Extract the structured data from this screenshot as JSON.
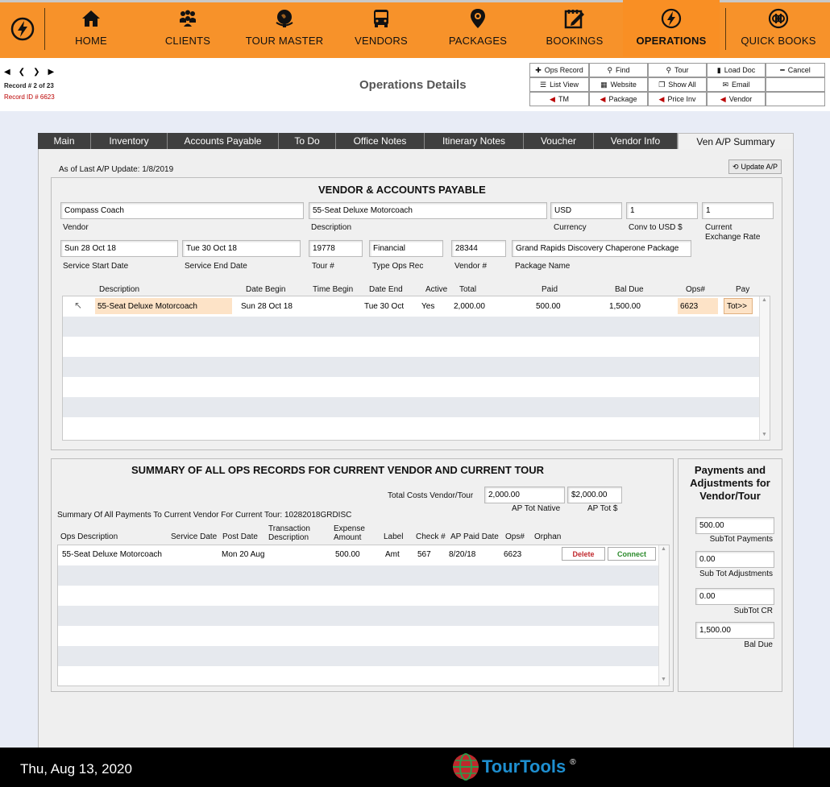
{
  "nav": {
    "items": [
      {
        "label": "HOME",
        "icon": "home-icon"
      },
      {
        "label": "CLIENTS",
        "icon": "clients-icon"
      },
      {
        "label": "TOUR MASTER",
        "icon": "globe-icon"
      },
      {
        "label": "VENDORS",
        "icon": "bus-icon"
      },
      {
        "label": "PACKAGES",
        "icon": "location-pin-icon"
      },
      {
        "label": "BOOKINGS",
        "icon": "booking-edit-icon"
      },
      {
        "label": "OPERATIONS",
        "icon": "lightning-icon"
      },
      {
        "label": "QUICK BOOKS",
        "icon": "quickbooks-icon"
      }
    ],
    "active": "OPERATIONS",
    "accent": "#f7922a"
  },
  "header": {
    "record_num": "Record # 2 of 23",
    "record_id": "Record ID # 6623",
    "title": "Operations Details",
    "buttons": [
      {
        "label": "Ops Record",
        "icon": "plus-icon"
      },
      {
        "label": "Find",
        "icon": "search-icon"
      },
      {
        "label": "Tour",
        "icon": "search-icon"
      },
      {
        "label": "Load Doc",
        "icon": "document-icon"
      },
      {
        "label": "Cancel",
        "icon": "minus-icon"
      },
      {
        "label": "List View",
        "icon": "list-icon"
      },
      {
        "label": "Website",
        "icon": "table-icon"
      },
      {
        "label": "Show All",
        "icon": "copy-icon"
      },
      {
        "label": "Email",
        "icon": "envelope-icon"
      },
      {
        "label": "",
        "icon": "blank"
      },
      {
        "label": "TM",
        "icon": "caret-left-icon"
      },
      {
        "label": "Package",
        "icon": "caret-left-icon"
      },
      {
        "label": "Price Inv",
        "icon": "caret-left-icon"
      },
      {
        "label": "Vendor",
        "icon": "caret-left-icon"
      },
      {
        "label": "",
        "icon": "blank"
      }
    ]
  },
  "tabs": [
    "Main",
    "Inventory",
    "Accounts Payable",
    "To Do",
    "Office Notes",
    "Itinerary Notes",
    "Voucher",
    "Vendor Info",
    "Ven A/P Summary"
  ],
  "active_tab": "Ven A/P Summary",
  "ap": {
    "last_update": "As of Last A/P Update: 1/8/2019",
    "update_btn": "Update A/P",
    "section_title": "VENDOR & ACCOUNTS PAYABLE",
    "vendor": {
      "value": "Compass Coach",
      "label": "Vendor"
    },
    "description": {
      "value": "55-Seat Deluxe Motorcoach",
      "label": "Description"
    },
    "currency": {
      "value": "USD",
      "label": "Currency"
    },
    "conv": {
      "value": "1",
      "label": "Conv to USD $"
    },
    "exchange": {
      "value": "1",
      "label": "Current Exchange Rate"
    },
    "start_date": {
      "value": "Sun 28 Oct 18",
      "label": "Service Start Date"
    },
    "end_date": {
      "value": "Tue 30 Oct 18",
      "label": "Service End Date"
    },
    "tour_num": {
      "value": "19778",
      "label": "Tour #"
    },
    "type_ops": {
      "value": "Financial",
      "label": "Type Ops Rec"
    },
    "vendor_num": {
      "value": "28344",
      "label": "Vendor #"
    },
    "package_name": {
      "value": "Grand Rapids Discovery Chaperone Package",
      "label": "Package Name"
    },
    "columns": [
      "Description",
      "Date Begin",
      "Time Begin",
      "Date End",
      "Active",
      "Total",
      "Paid",
      "Bal Due",
      "Ops#",
      "Pay"
    ],
    "row": {
      "description": "55-Seat Deluxe Motorcoach",
      "date_begin": "Sun 28 Oct 18",
      "time_begin": "",
      "date_end": "Tue 30 Oct",
      "active": "Yes",
      "total": "2,000.00",
      "paid": "500.00",
      "bal_due": "1,500.00",
      "ops": "6623",
      "pay": "Tot>>"
    }
  },
  "summary": {
    "title": "SUMMARY OF ALL OPS RECORDS FOR CURRENT VENDOR AND CURRENT TOUR",
    "total_costs_label": "Total Costs Vendor/Tour",
    "ap_native": "2,000.00",
    "ap_native_label": "AP Tot Native",
    "ap_usd": "$2,000.00",
    "ap_usd_label": "AP Tot $",
    "payments_line": "Summary Of All Payments To Current Vendor For Current Tour: 10282018GRDISC",
    "columns": {
      "ops_desc": "Ops Description",
      "service_date": "Service Date",
      "post_date": "Post Date",
      "trans_desc": "Transaction Description",
      "expense": "Expense Amount",
      "label": "Label",
      "check": "Check #",
      "ap_paid": "AP Paid Date",
      "ops": "Ops#",
      "orphan": "Orphan"
    },
    "row": {
      "ops_desc": "55-Seat Deluxe Motorcoach",
      "service_date": "",
      "post_date": "Mon 20 Aug",
      "trans_desc": "",
      "expense": "500.00",
      "label": "Amt",
      "check": "567",
      "ap_paid": "8/20/18",
      "ops": "6623",
      "delete": "Delete",
      "connect": "Connect"
    }
  },
  "payments": {
    "title": "Payments and Adjustments for Vendor/Tour",
    "subtot_payments": "500.00",
    "subtot_payments_label": "SubTot Payments",
    "subtot_adjust": "0.00",
    "subtot_adjust_label": "Sub Tot Adjustments",
    "subtot_cr": "0.00",
    "subtot_cr_label": "SubTot CR",
    "bal_due": "1,500.00",
    "bal_due_label": "Bal Due"
  },
  "footer": {
    "date": "Thu, Aug 13, 2020",
    "brand": "TourTools",
    "reg": "®"
  }
}
